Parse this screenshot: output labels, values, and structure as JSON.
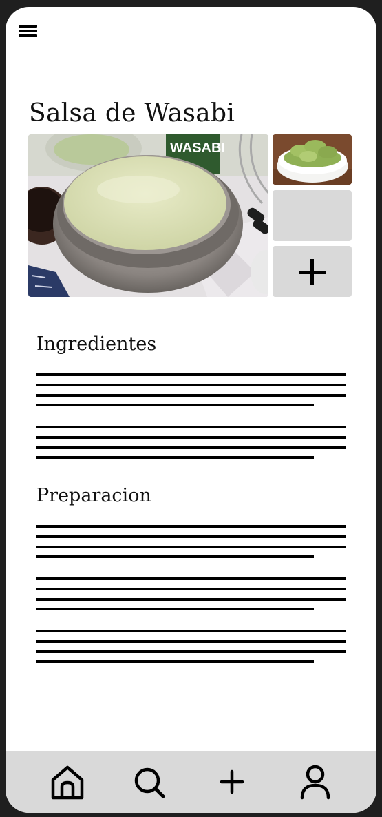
{
  "header": {
    "menu_icon": "hamburger-menu-icon"
  },
  "recipe": {
    "title": "Salsa de Wasabi",
    "main_photo_label": "WASABI"
  },
  "gallery": {
    "add_icon": "plus-icon"
  },
  "sections": {
    "ingredients_title": "Ingredientes",
    "preparation_title": "Preparacion"
  },
  "bottom_nav": {
    "items": [
      {
        "icon": "home-icon"
      },
      {
        "icon": "search-icon"
      },
      {
        "icon": "plus-icon"
      },
      {
        "icon": "user-icon"
      }
    ]
  },
  "colors": {
    "nav_background": "#d9d9d9",
    "placeholder": "#d9d9d9",
    "wasabi_green": "#8fb054",
    "sauce": "#dfe3b6"
  }
}
